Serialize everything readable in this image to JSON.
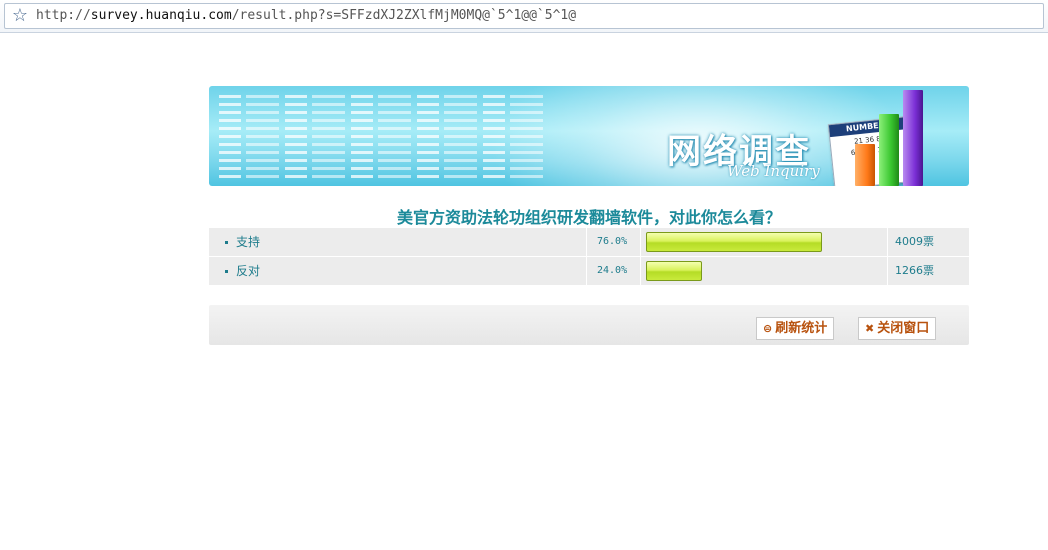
{
  "address_bar": {
    "url_prefix": "http://",
    "url_host": "survey.huanqiu.com",
    "url_path": "/result.php?s=SFFzdXJ2ZXlfMjM0MQ@`5^1@@`5^1@",
    "bookmark_icon": "star-icon"
  },
  "banner": {
    "title": "网络调查",
    "subtitle": "Web Inquiry",
    "card_header": "NUMBERS",
    "card_rows": [
      "21  36  84",
      "63  127  158"
    ],
    "bar_colors": [
      "#ff7a1a",
      "#39c62f",
      "#7b2fd6"
    ]
  },
  "survey": {
    "title": "美官方资助法轮功组织研发翻墙软件，对此你怎么看？",
    "options": [
      {
        "label": "支持",
        "percent_text": "76.0%",
        "percent": 76.0,
        "votes": "4009票"
      },
      {
        "label": "反对",
        "percent_text": "24.0%",
        "percent": 24.0,
        "votes": "1266票"
      }
    ]
  },
  "actions": {
    "refresh_label": "刷新统计",
    "refresh_icon": "refresh-icon",
    "close_label": "关闭窗口",
    "close_icon": "close-icon"
  },
  "colors": {
    "accent": "#1c8a9a",
    "bar_fill": "#c9ea3c",
    "button_text": "#b8520e"
  }
}
